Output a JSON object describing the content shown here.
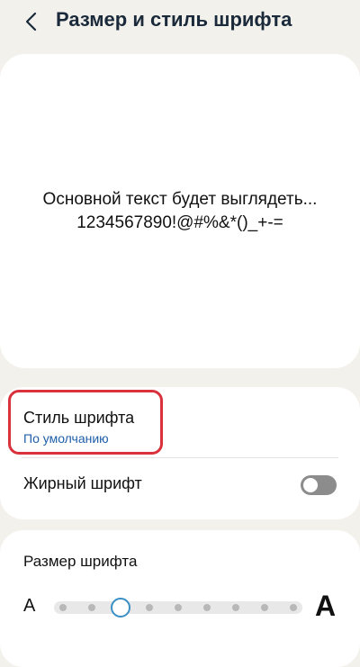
{
  "header": {
    "title": "Размер и стиль шрифта",
    "back_icon": "chevron-left-icon"
  },
  "preview": {
    "line1": "Основной текст будет выглядеть...",
    "line2": "1234567890!@#%&*()_+-="
  },
  "font_style": {
    "label": "Стиль шрифта",
    "value": "По умолчанию",
    "highlight_color": "#d9323c",
    "value_color": "#1f5fa8"
  },
  "bold_font": {
    "label": "Жирный шрифт",
    "enabled": false
  },
  "font_size": {
    "label": "Размер шрифта",
    "small_glyph": "A",
    "large_glyph": "A",
    "steps": 9,
    "selected_step": 2
  }
}
